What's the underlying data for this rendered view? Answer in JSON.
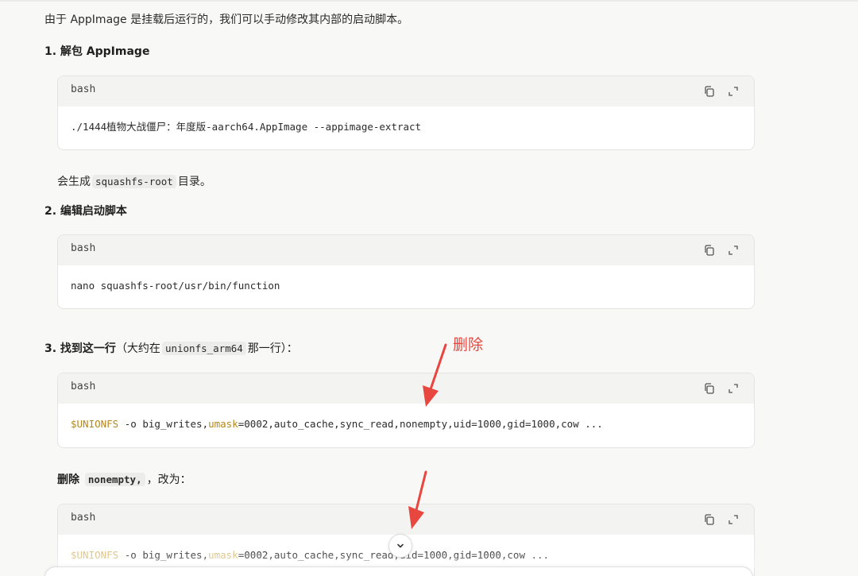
{
  "intro_text": "由于 AppImage 是挂载后运行的，我们可以手动修改其内部的启动脚本。",
  "step1": {
    "title": "1. 解包 AppImage",
    "code": {
      "lang": "bash",
      "line": "./1444植物大战僵尸：年度版-aarch64.AppImage --appimage-extract"
    },
    "after_prefix": "会生成",
    "after_code": "squashfs-root",
    "after_suffix": "目录。"
  },
  "step2": {
    "title": "2. 编辑启动脚本",
    "code": {
      "lang": "bash",
      "line": "nano squashfs-root/usr/bin/function"
    }
  },
  "step3": {
    "title": "3. 找到这一行",
    "title_paren_open": "（大约在",
    "title_code": "unionfs_arm64",
    "title_paren_close": "那一行）：",
    "code": {
      "lang": "bash",
      "var1": "$UNIONFS",
      "part1": " -o big_writes,",
      "var2": "umask",
      "part2": "=0002,auto_cache,sync_read,nonempty,uid=1000,gid=1000,cow ..."
    }
  },
  "annotation": "删除",
  "delete_note": {
    "label": "删除",
    "code": "nonempty,",
    "suffix": "，改为："
  },
  "step4_code": {
    "lang": "bash",
    "var1": "$UNIONFS",
    "part1": " -o big_writes,",
    "var2": "umask",
    "part2": "=0002,auto_cache,sync_read,uid=1000,gid=1000,cow ..."
  },
  "colors": {
    "accent_red": "#e8473f",
    "code_var": "#b5871d"
  },
  "icons": {
    "copy": "copy-icon",
    "expand": "expand-icon",
    "scroll_down": "chevron-down-icon"
  }
}
